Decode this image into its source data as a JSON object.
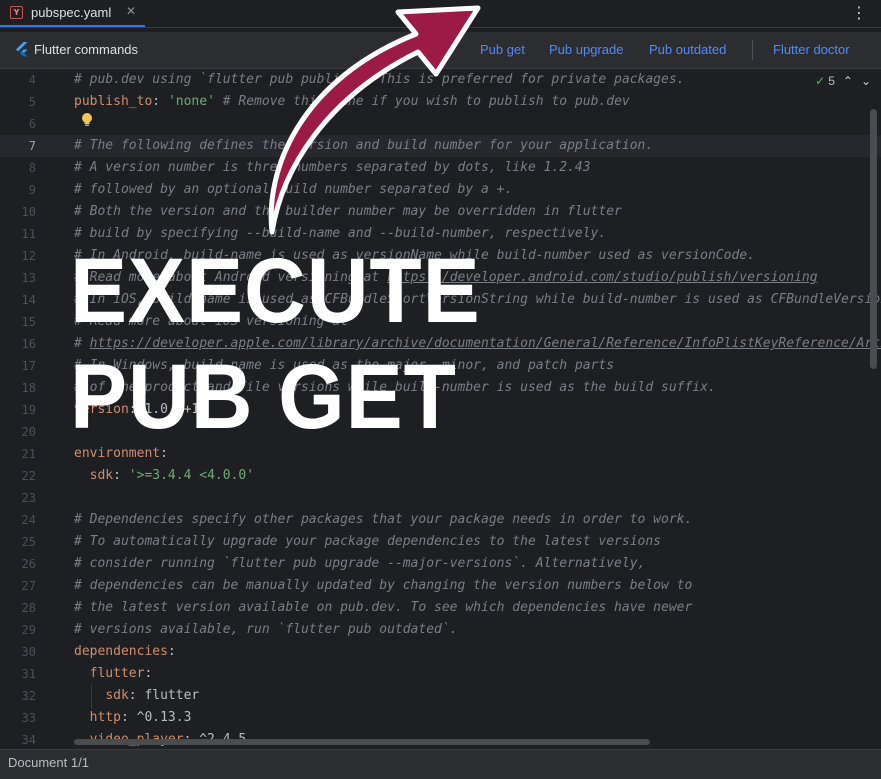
{
  "tab": {
    "icon_letter": "Y",
    "filename": "pubspec.yaml",
    "close": "✕",
    "menu": "⋮"
  },
  "flutter_bar": {
    "title": "Flutter commands",
    "commands": [
      "Pub get",
      "Pub upgrade",
      "Pub outdated",
      "Flutter doctor"
    ]
  },
  "inspections": {
    "count": "5",
    "up": "⌃",
    "down": "⌄"
  },
  "editor": {
    "lines": [
      {
        "n": "4",
        "text": "# pub.dev using `flutter pub publish`. This is preferred for private packages."
      },
      {
        "n": "5",
        "text": "publish_to: 'none' # Remove this line if you wish to publish to pub.dev"
      },
      {
        "n": "6",
        "text": ""
      },
      {
        "n": "7",
        "text": "# The following defines the version and build number for your application."
      },
      {
        "n": "8",
        "text": "# A version number is three numbers separated by dots, like 1.2.43"
      },
      {
        "n": "9",
        "text": "# followed by an optional build number separated by a +."
      },
      {
        "n": "10",
        "text": "# Both the version and the builder number may be overridden in flutter"
      },
      {
        "n": "11",
        "text": "# build by specifying --build-name and --build-number, respectively."
      },
      {
        "n": "12",
        "text": "# In Android, build-name is used as versionName while build-number used as versionCode."
      },
      {
        "n": "13",
        "text": "# Read more about Android versioning at https://developer.android.com/studio/publish/versioning"
      },
      {
        "n": "14",
        "text": "# In iOS, build-name is used as CFBundleShortVersionString while build-number is used as CFBundleVersion."
      },
      {
        "n": "15",
        "text": "# Read more about iOS versioning at"
      },
      {
        "n": "16",
        "text": "# https://developer.apple.com/library/archive/documentation/General/Reference/InfoPlistKeyReference/Articles/CoreFoundationKeys.html"
      },
      {
        "n": "17",
        "text": "# In Windows, build-name is used as the major, minor, and patch parts"
      },
      {
        "n": "18",
        "text": "# of the product and file versions while build-number is used as the build suffix."
      },
      {
        "n": "19",
        "text": "version: 1.0.0+1"
      },
      {
        "n": "20",
        "text": ""
      },
      {
        "n": "21",
        "text": "environment:"
      },
      {
        "n": "22",
        "text": "  sdk: '>=3.4.4 <4.0.0'"
      },
      {
        "n": "23",
        "text": ""
      },
      {
        "n": "24",
        "text": "# Dependencies specify other packages that your package needs in order to work."
      },
      {
        "n": "25",
        "text": "# To automatically upgrade your package dependencies to the latest versions"
      },
      {
        "n": "26",
        "text": "# consider running `flutter pub upgrade --major-versions`. Alternatively,"
      },
      {
        "n": "27",
        "text": "# dependencies can be manually updated by changing the version numbers below to"
      },
      {
        "n": "28",
        "text": "# the latest version available on pub.dev. To see which dependencies have newer"
      },
      {
        "n": "29",
        "text": "# versions available, run `flutter pub outdated`."
      },
      {
        "n": "30",
        "text": "dependencies:"
      },
      {
        "n": "31",
        "text": "  flutter:"
      },
      {
        "n": "32",
        "text": "    sdk: flutter"
      },
      {
        "n": "33",
        "text": "  http: ^0.13.3"
      },
      {
        "n": "34",
        "text": "  video_player: ^2.4.5"
      }
    ],
    "current_line": "7"
  },
  "overlay": {
    "headline_line1": "EXECUTE",
    "headline_line2": "PUB GET",
    "arrow_color": "#9c1a46"
  },
  "status": {
    "document": "Document 1/1"
  },
  "colors": {
    "background": "#1e1f22",
    "toolbar": "#2b2d30",
    "link": "#548af7",
    "comment": "#7a7e85",
    "key": "#cf8e6d",
    "string": "#6aab73"
  }
}
